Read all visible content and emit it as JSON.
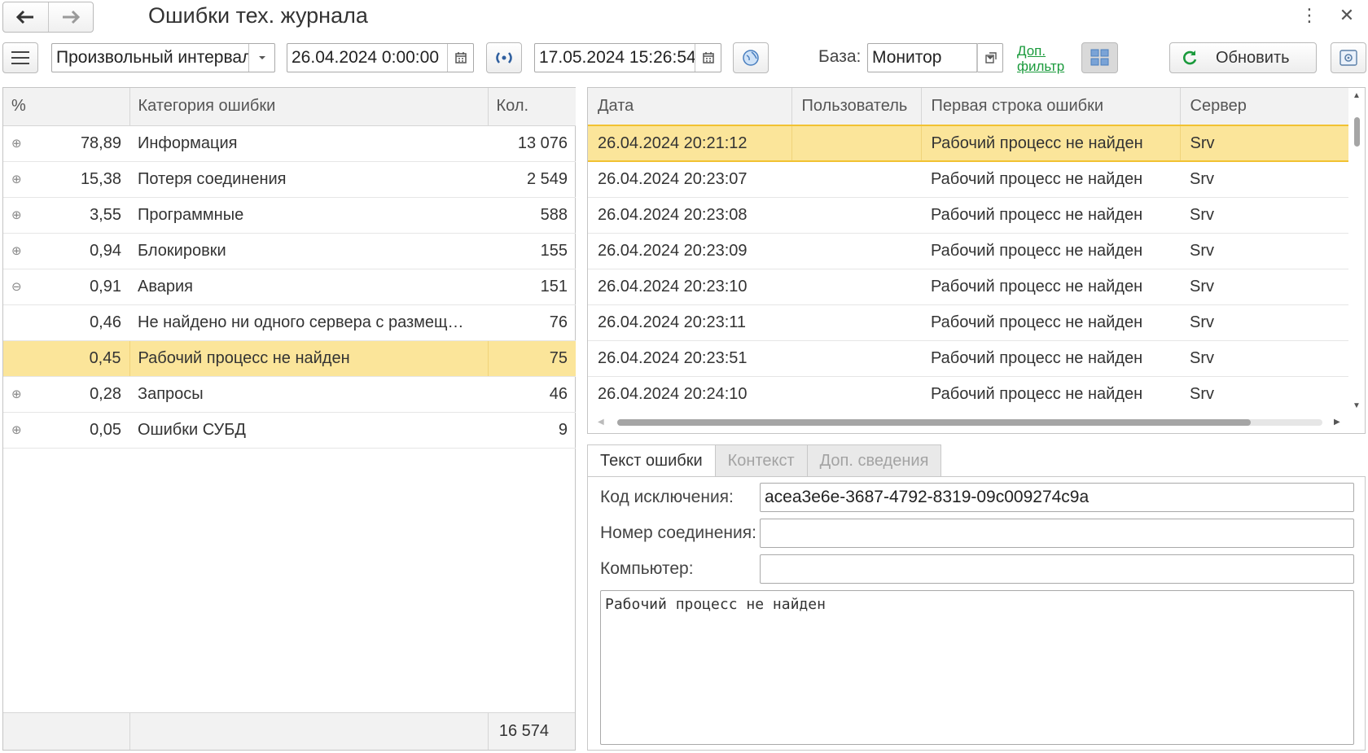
{
  "window": {
    "title": "Ошибки тех. журнала",
    "icons": {
      "back": "arrow-left-icon",
      "forward": "arrow-right-icon",
      "more": "more-vertical-icon",
      "close": "close-icon"
    }
  },
  "toolbar": {
    "period": "Произвольный интервал",
    "date_from": "26.04.2024  0:00:00",
    "date_to": "17.05.2024 15:26:54",
    "base_label": "База:",
    "base_value": "Монитор",
    "extra_filter_line1": "Доп.",
    "extra_filter_line2": "фильтр",
    "refresh_label": "Обновить",
    "colors": {
      "refresh_icon": "#1a9a3c",
      "link": "#1a9a3c",
      "toggle_bg": "#d9d9d9"
    }
  },
  "categories": {
    "columns": [
      "%",
      "Категория ошибки",
      "Кол."
    ],
    "rows": [
      {
        "pct": "78,89",
        "name": "Информация",
        "count": "13 076",
        "expander": "plus"
      },
      {
        "pct": "15,38",
        "name": "Потеря соединения",
        "count": "2 549",
        "expander": "plus"
      },
      {
        "pct": "3,55",
        "name": "Программные",
        "count": "588",
        "expander": "plus"
      },
      {
        "pct": "0,94",
        "name": "Блокировки",
        "count": "155",
        "expander": "plus"
      },
      {
        "pct": "0,91",
        "name": "Авария",
        "count": "151",
        "expander": "minus"
      },
      {
        "pct": "0,46",
        "name": "Не найдено ни одного сервера с размещ…",
        "count": "76",
        "expander": "none"
      },
      {
        "pct": "0,45",
        "name": "Рабочий процесс не найден",
        "count": "75",
        "expander": "none",
        "selected": true
      },
      {
        "pct": "0,28",
        "name": "Запросы",
        "count": "46",
        "expander": "plus"
      },
      {
        "pct": "0,05",
        "name": "Ошибки СУБД",
        "count": "9",
        "expander": "plus"
      }
    ],
    "total": "16 574"
  },
  "events": {
    "columns": [
      "Дата",
      "Пользователь",
      "Первая строка ошибки",
      "Сервер"
    ],
    "rows": [
      {
        "date": "26.04.2024 20:21:12",
        "user": "",
        "message": "Рабочий процесс не найден",
        "server": "Srv",
        "selected": true
      },
      {
        "date": "26.04.2024 20:23:07",
        "user": "",
        "message": "Рабочий процесс не найден",
        "server": "Srv"
      },
      {
        "date": "26.04.2024 20:23:08",
        "user": "",
        "message": "Рабочий процесс не найден",
        "server": "Srv"
      },
      {
        "date": "26.04.2024 20:23:09",
        "user": "",
        "message": "Рабочий процесс не найден",
        "server": "Srv"
      },
      {
        "date": "26.04.2024 20:23:10",
        "user": "",
        "message": "Рабочий процесс не найден",
        "server": "Srv"
      },
      {
        "date": "26.04.2024 20:23:11",
        "user": "",
        "message": "Рабочий процесс не найден",
        "server": "Srv"
      },
      {
        "date": "26.04.2024 20:23:51",
        "user": "",
        "message": "Рабочий процесс не найден",
        "server": "Srv"
      },
      {
        "date": "26.04.2024 20:24:10",
        "user": "",
        "message": "Рабочий процесс не найден",
        "server": "Srv"
      }
    ]
  },
  "details": {
    "tabs": [
      "Текст ошибки",
      "Контекст",
      "Доп. сведения"
    ],
    "active_tab": 0,
    "exception_label": "Код исключения:",
    "exception_value": "acea3e6e-3687-4792-8319-09c009274c9a",
    "connection_label": "Номер соединения:",
    "connection_value": "",
    "computer_label": "Компьютер:",
    "computer_value": "",
    "text": "Рабочий процесс не найден"
  },
  "colors": {
    "selection": "#fbe59a",
    "selection_border": "#f1c232",
    "header_bg": "#f2f2f2"
  }
}
